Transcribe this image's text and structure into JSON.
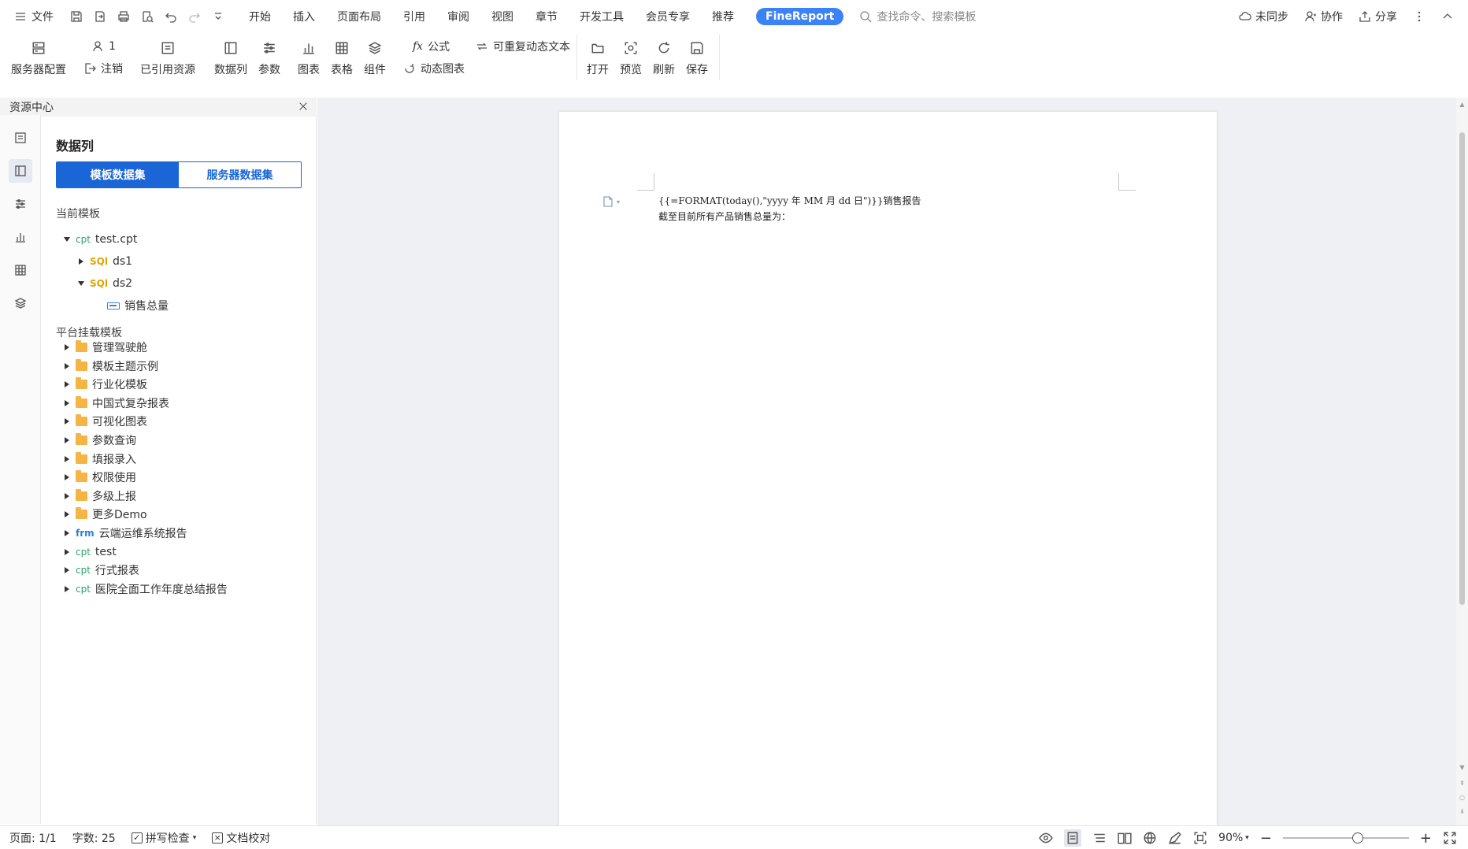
{
  "menubar": {
    "file_label": "文件",
    "tabs": [
      "开始",
      "插入",
      "页面布局",
      "引用",
      "审阅",
      "视图",
      "章节",
      "开发工具",
      "会员专享",
      "推荐"
    ],
    "finereport_tab": "FineReport",
    "search_placeholder": "查找命令、搜索模板",
    "right": {
      "sync": "未同步",
      "collab": "协作",
      "share": "分享"
    }
  },
  "ribbon": {
    "server_config": "服务器配置",
    "user_count": "1",
    "logout": "注销",
    "referenced_resources": "已引用资源",
    "data_column": "数据列",
    "params": "参数",
    "chart": "图表",
    "table": "表格",
    "component": "组件",
    "formula": "公式",
    "repeatable_text": "可重复动态文本",
    "dynamic_chart": "动态图表",
    "open": "打开",
    "preview": "预览",
    "refresh": "刷新",
    "save": "保存"
  },
  "panel": {
    "header": "资源中心",
    "title": "数据列",
    "toggle_template": "模板数据集",
    "toggle_server": "服务器数据集",
    "current_template_label": "当前模板",
    "current_tree": {
      "file_tag": "cpt",
      "file_name": "test.cpt",
      "ds1_tag": "SQl",
      "ds1": "ds1",
      "ds2_tag": "SQl",
      "ds2": "ds2",
      "field": "销售总量"
    },
    "platform_label": "平台挂载模板",
    "platform_items": [
      {
        "kind": "folder",
        "tag": "",
        "label": "管理驾驶舱"
      },
      {
        "kind": "folder",
        "tag": "",
        "label": "模板主题示例"
      },
      {
        "kind": "folder",
        "tag": "",
        "label": "行业化模板"
      },
      {
        "kind": "folder",
        "tag": "",
        "label": "中国式复杂报表"
      },
      {
        "kind": "folder",
        "tag": "",
        "label": "可视化图表"
      },
      {
        "kind": "folder",
        "tag": "",
        "label": "参数查询"
      },
      {
        "kind": "folder",
        "tag": "",
        "label": "填报录入"
      },
      {
        "kind": "folder",
        "tag": "",
        "label": "权限使用"
      },
      {
        "kind": "folder",
        "tag": "",
        "label": "多级上报"
      },
      {
        "kind": "folder",
        "tag": "",
        "label": "更多Demo"
      },
      {
        "kind": "frm",
        "tag": "frm",
        "label": "云端运维系统报告"
      },
      {
        "kind": "cpt",
        "tag": "cpt",
        "label": "test"
      },
      {
        "kind": "cpt",
        "tag": "cpt",
        "label": "行式报表"
      },
      {
        "kind": "cpt",
        "tag": "cpt",
        "label": "医院全面工作年度总结报告"
      }
    ]
  },
  "document": {
    "line1": "{{=FORMAT(today(),\"yyyy 年 MM 月 dd 日\")}}销售报告",
    "line2": "截至目前所有产品销售总量为："
  },
  "statusbar": {
    "page": "页面: 1/1",
    "words": "字数: 25",
    "spellcheck": "拼写检查",
    "proofread": "文档校对",
    "zoom": "90%",
    "zoom_level": 0.6
  },
  "colors": {
    "accent": "#1a66d6",
    "finereport_pill": "#3b82f6",
    "folder": "#f4b545",
    "cpt_tag": "#2aa56a",
    "sql_tag": "#e2a400"
  }
}
